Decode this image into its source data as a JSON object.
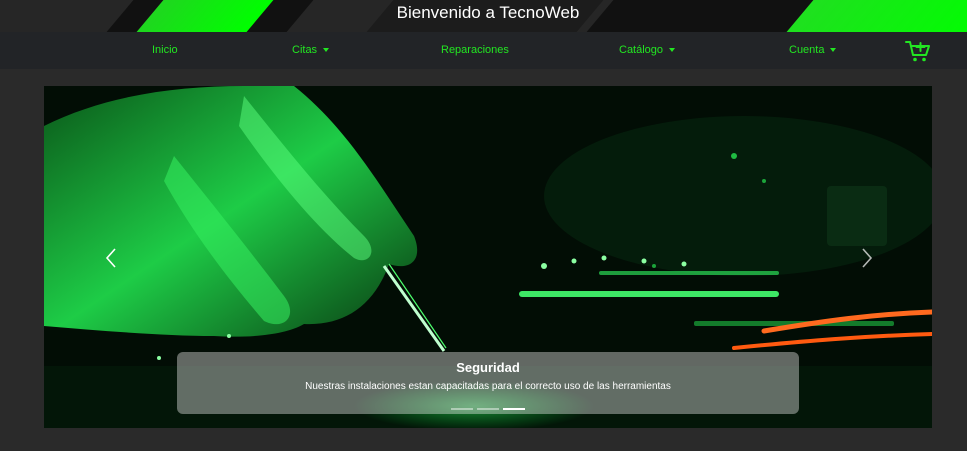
{
  "header": {
    "title": "Bienvenido a TecnoWeb"
  },
  "nav": {
    "items": [
      {
        "label": "Inicio",
        "dropdown": false
      },
      {
        "label": "Citas",
        "dropdown": true
      },
      {
        "label": "Reparaciones",
        "dropdown": false
      },
      {
        "label": "Catálogo",
        "dropdown": true
      },
      {
        "label": "Cuenta",
        "dropdown": true
      }
    ],
    "cart_icon": "cart-plus-icon"
  },
  "carousel": {
    "caption_title": "Seguridad",
    "caption_text": "Nuestras instalaciones estan capacitadas para el correcto uso de las herramientas",
    "indicators": 3,
    "active_indicator": 2,
    "prev_icon": "chevron-left-icon",
    "next_icon": "chevron-right-icon"
  },
  "colors": {
    "accent": "#22e622",
    "background": "#2a2a2a",
    "navbar": "#222427"
  }
}
